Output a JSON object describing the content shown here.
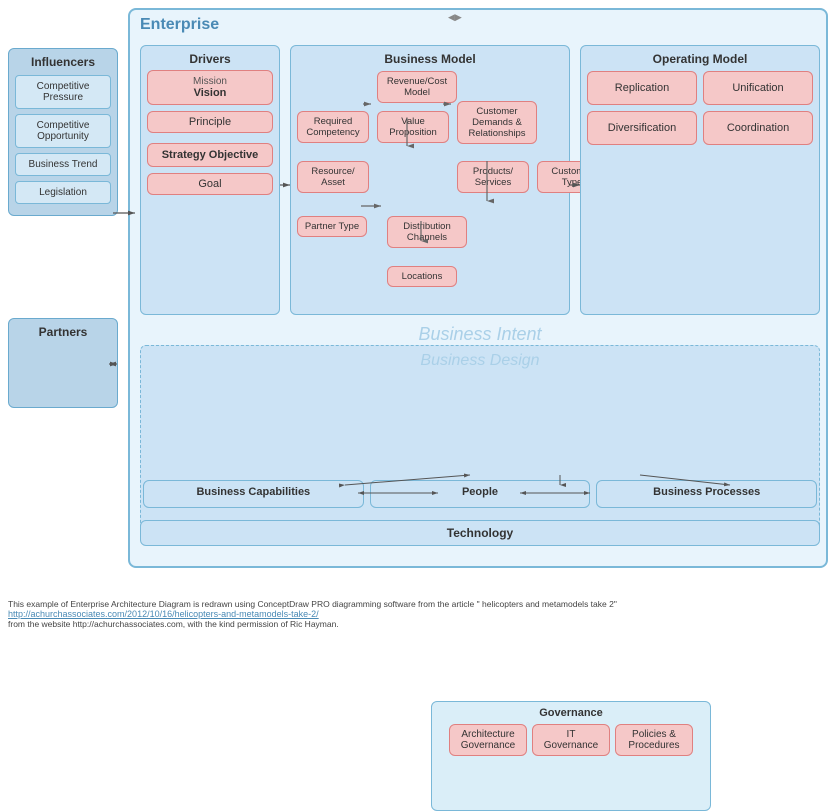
{
  "title": "Enterprise",
  "influencers": {
    "title": "Influencers",
    "items": [
      "Competitive Pressure",
      "Competitive Opportunity",
      "Business Trend",
      "Legislation"
    ]
  },
  "partners": {
    "title": "Partners"
  },
  "drivers": {
    "title": "Drivers",
    "mission": "Mission",
    "vision": "Vision",
    "principle": "Principle",
    "strategy": "Strategy Objective",
    "goal": "Goal"
  },
  "businessModel": {
    "title": "Business Model",
    "items": {
      "revenueCost": "Revenue/Cost Model",
      "requiredCompetency": "Required Competency",
      "valueProposition": "Value Proposition",
      "customerDemands": "Customer Demands & Relationships",
      "resourceAsset": "Resource/ Asset",
      "productsServices": "Products/ Services",
      "customerType": "Customer Type",
      "partnerType": "Partner Type",
      "distributionChannels": "Distribution Channels",
      "locations": "Locations"
    }
  },
  "operatingModel": {
    "title": "Operating Model",
    "items": [
      "Replication",
      "Unification",
      "Diversification",
      "Coordination"
    ]
  },
  "businessIntent": "Business Intent",
  "businessDesign": {
    "title": "Business Design",
    "governance": {
      "title": "Governance",
      "items": [
        "Architecture Governance",
        "IT Governance",
        "Policies & Procedures"
      ]
    }
  },
  "bottomSections": {
    "capabilities": "Business Capabilities",
    "people": "People",
    "processes": "Business Processes"
  },
  "technology": "Technology",
  "footer": {
    "line1": "This example of Enterprise Architecture Diagram is redrawn using ConceptDraw PRO diagramming software from the article \" helicopters and metamodels take 2\"",
    "link": "http://achurchassociates.com/2012/10/16/helicopters-and-metamodels-take-2/",
    "line2": "from the website http://achurchassociates.com, with the kind permission of Ric Hayman."
  }
}
